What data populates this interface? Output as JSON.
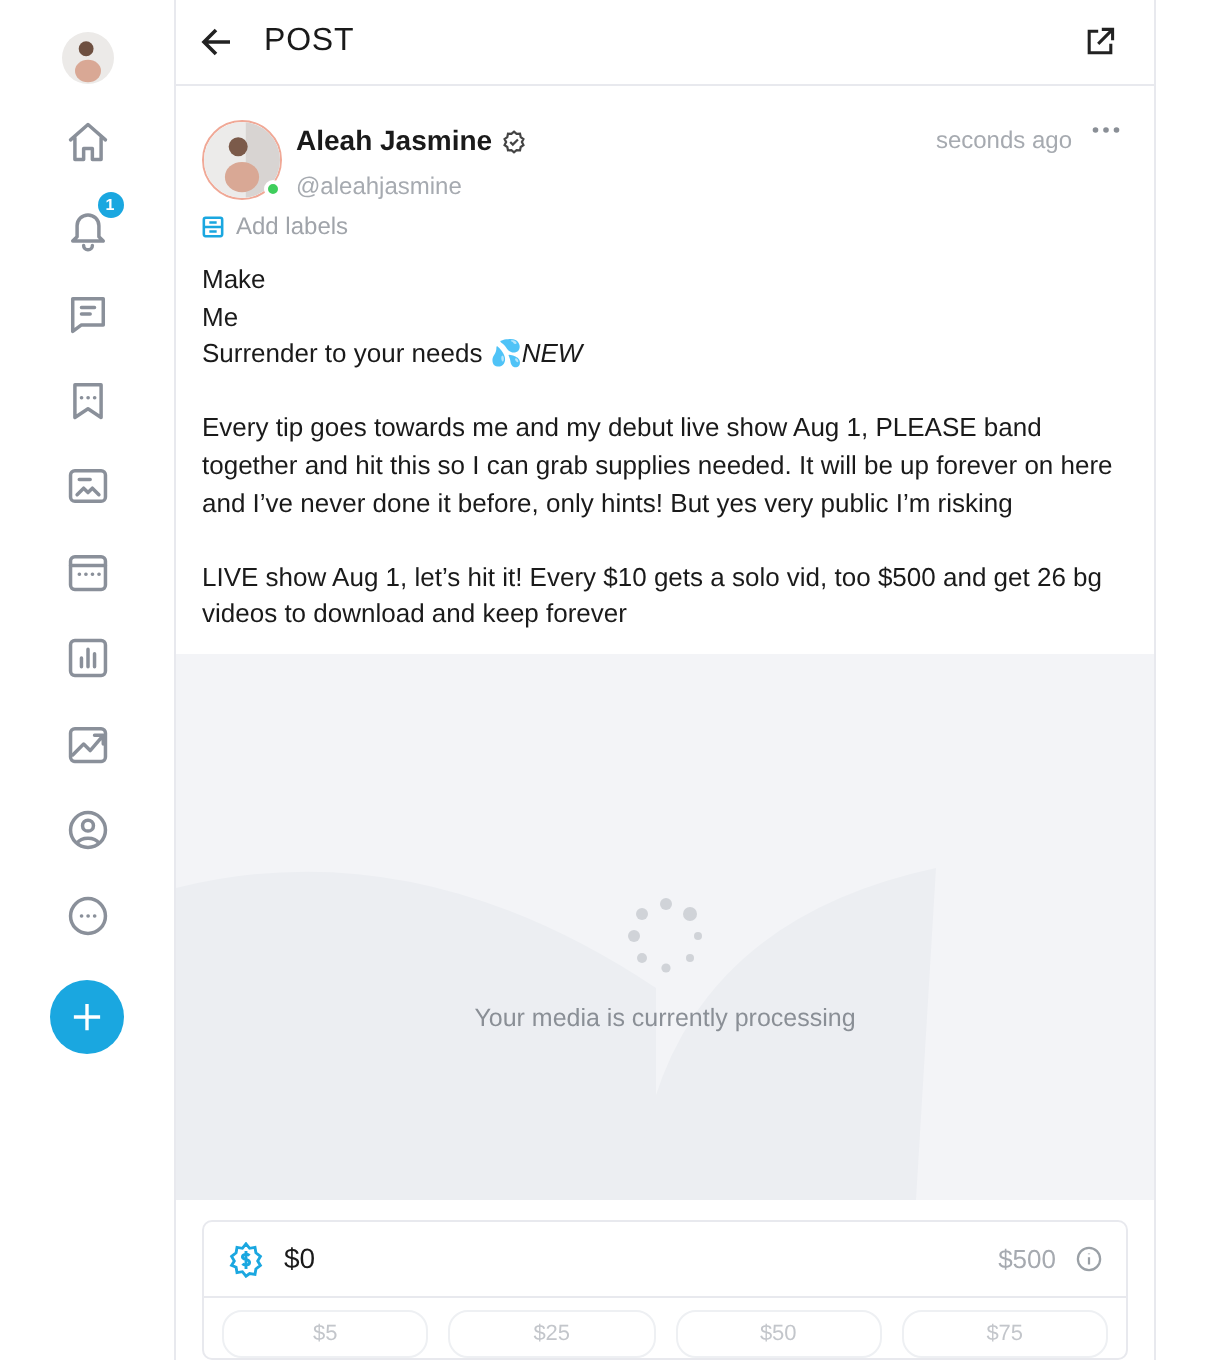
{
  "sidebar": {
    "notifications_badge": "1"
  },
  "header": {
    "title": "POST"
  },
  "post": {
    "author": "Aleah Jasmine",
    "verified": true,
    "online": true,
    "handle": "@aleahjasmine",
    "time": "seconds ago",
    "add_labels": "Add labels",
    "paragraphs": [
      [
        "Make",
        "Me",
        "Surrender to your needs 💦*NEW*"
      ],
      [
        "Every tip goes towards me and my debut live show Aug 1, PLEASE band together and hit this so I can grab supplies needed. It will be up forever on here and I’ve never done it before, only hints! But yes very public I’m risking"
      ],
      [
        "LIVE show Aug 1, let’s hit it! Every $10 gets a solo vid, too $500 and get 26 bg videos to download and keep forever"
      ]
    ],
    "media": {
      "status": "Your media is currently processing"
    }
  },
  "tip_goal": {
    "raised": "$0",
    "goal": "$500",
    "amounts": [
      "$5",
      "$25",
      "$50",
      "$75"
    ]
  }
}
